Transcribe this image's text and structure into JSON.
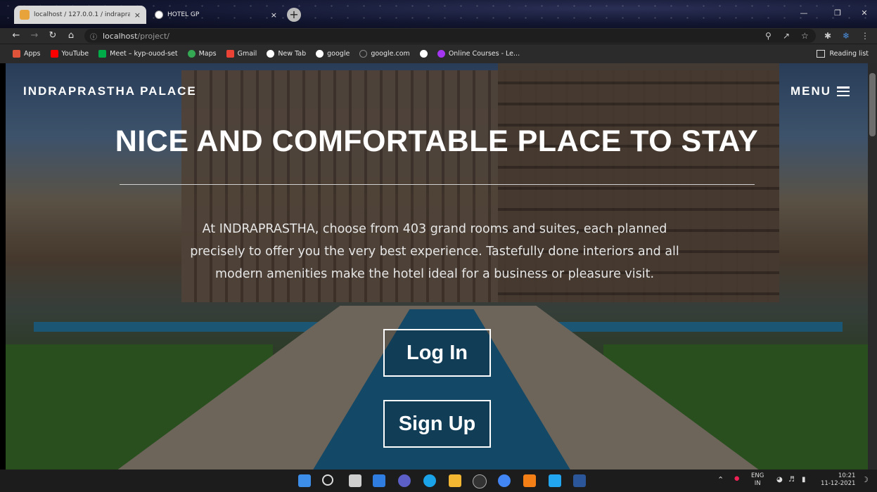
{
  "browser": {
    "tabs": [
      {
        "title": "localhost / 127.0.0.1 / indraprast...",
        "active": true
      },
      {
        "title": "HOTEL GP",
        "active": false
      }
    ],
    "new_tab_glyph": "+",
    "close_glyph": "×",
    "url_host": "localhost",
    "url_path": "/project/",
    "bookmarks": [
      {
        "label": "Apps",
        "icon": "apps-grid-icon",
        "color": "#e0533b"
      },
      {
        "label": "YouTube",
        "icon": "youtube-icon",
        "color": "#ff0000"
      },
      {
        "label": "Meet – kyp-ouod-set",
        "icon": "meet-icon",
        "color": "#00ac47"
      },
      {
        "label": "Maps",
        "icon": "maps-pin-icon",
        "color": "#34a853"
      },
      {
        "label": "Gmail",
        "icon": "gmail-icon",
        "color": "#ea4335"
      },
      {
        "label": "New Tab",
        "icon": "globe-icon",
        "color": "#ffffff"
      },
      {
        "label": "google",
        "icon": "globe-icon",
        "color": "#ffffff"
      },
      {
        "label": "google.com",
        "icon": "search-icon",
        "color": "#888888"
      },
      {
        "label": "",
        "icon": "google-icon",
        "color": "#ffffff"
      },
      {
        "label": "Online Courses - Le...",
        "icon": "udemy-icon",
        "color": "#a435f0"
      }
    ],
    "reading_list": "Reading list"
  },
  "site": {
    "brand": "INDRAPRASTHA PALACE",
    "menu_label": "MENU",
    "headline": "NICE AND COMFORTABLE PLACE TO STAY",
    "intro": "At INDRAPRASTHA, choose from 403 grand rooms and suites, each planned precisely to offer you the very best experience. Tastefully done interiors and all modern amenities make the hotel ideal for a business or pleasure visit.",
    "login_label": "Log In",
    "signup_label": "Sign Up"
  },
  "taskbar": {
    "lang_top": "ENG",
    "lang_bottom": "IN",
    "time": "10:21",
    "date": "11-12-2021"
  }
}
